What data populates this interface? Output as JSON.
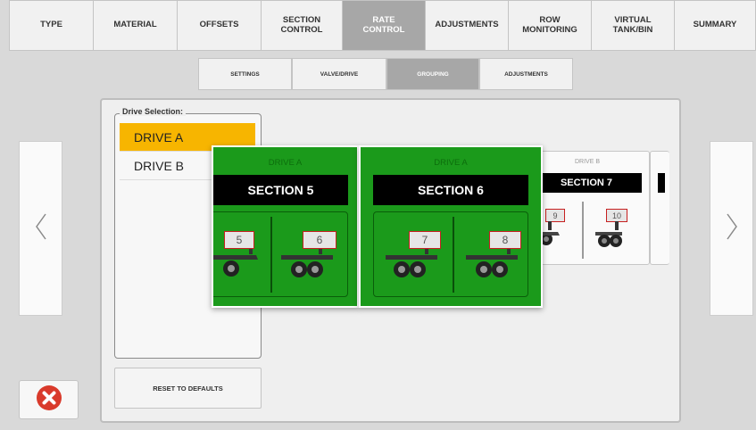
{
  "top_tabs": [
    {
      "label": "TYPE"
    },
    {
      "label": "MATERIAL"
    },
    {
      "label": "OFFSETS"
    },
    {
      "label": "SECTION\nCONTROL"
    },
    {
      "label": "RATE\nCONTROL"
    },
    {
      "label": "ADJUSTMENTS"
    },
    {
      "label": "ROW\nMONITORING"
    },
    {
      "label": "VIRTUAL\nTANK/BIN"
    },
    {
      "label": "SUMMARY"
    }
  ],
  "sub_tabs": [
    {
      "label": "SETTINGS"
    },
    {
      "label": "VALVE/DRIVE"
    },
    {
      "label": "GROUPING"
    },
    {
      "label": "ADJUSTMENTS"
    }
  ],
  "drive_selection": {
    "legend": "Drive Selection:",
    "items": [
      {
        "label": "DRIVE A"
      },
      {
        "label": "DRIVE B"
      }
    ]
  },
  "reset_button": "RESET TO DEFAULTS",
  "section_cards": [
    {
      "drive": "DRIVE A",
      "title": "SECTION 5",
      "rows": [
        "5",
        "6"
      ]
    },
    {
      "drive": "DRIVE A",
      "title": "SECTION 6",
      "rows": [
        "7",
        "8"
      ]
    }
  ],
  "background_card": {
    "drive": "DRIVE B",
    "title": "SECTION 7",
    "rows": [
      "9",
      "10"
    ]
  },
  "icons": {
    "left": "chevron-left-icon",
    "right": "chevron-right-icon",
    "close": "close-icon"
  },
  "colors": {
    "selected": "#f7b500",
    "card_green": "#1b9a1b",
    "close_red": "#d93a2b",
    "active_tab": "#a7a7a7"
  }
}
